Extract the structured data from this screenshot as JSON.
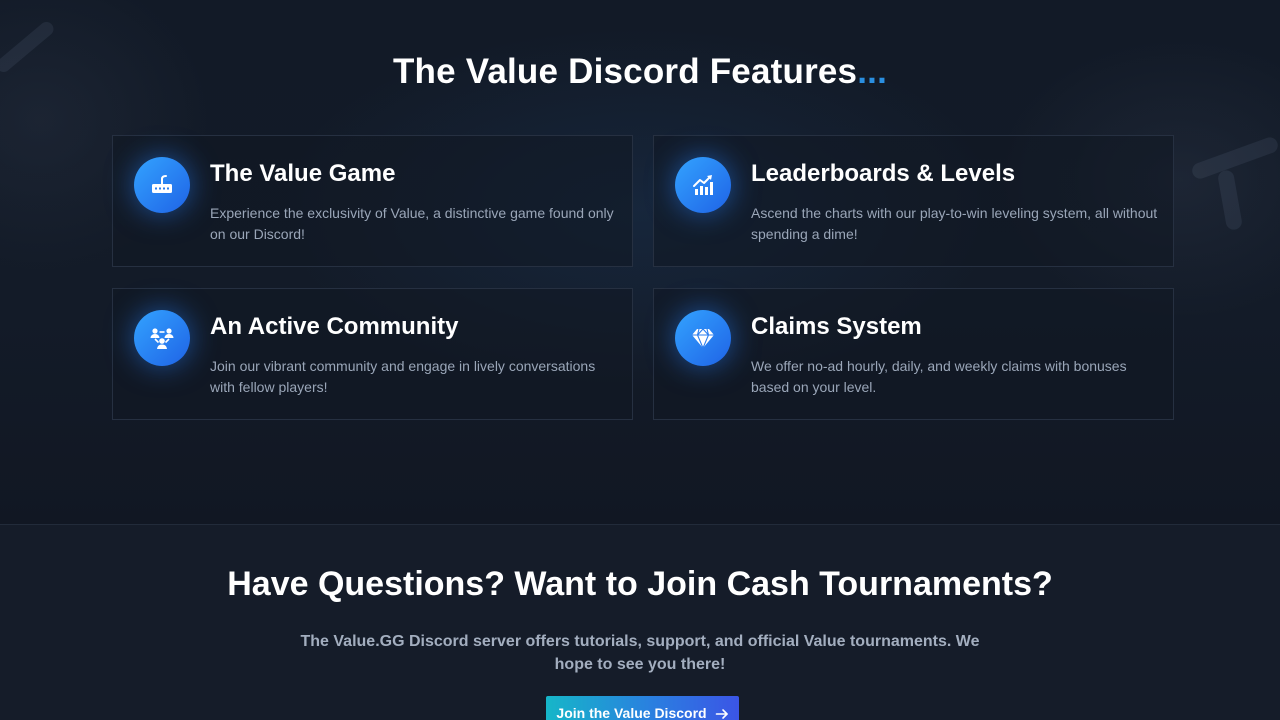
{
  "features": {
    "title": "The Value Discord Features",
    "title_suffix": "...",
    "accent_color": "#2a8fe0",
    "cards": [
      {
        "icon": "game-controller-icon",
        "title": "The Value Game",
        "description": "Experience the exclusivity of Value, a distinctive game found only on our Discord!"
      },
      {
        "icon": "chart-growth-icon",
        "title": "Leaderboards & Levels",
        "description": "Ascend the charts with our play-to-win leveling system, all without spending a dime!"
      },
      {
        "icon": "community-icon",
        "title": "An Active Community",
        "description": "Join our vibrant community and engage in lively conversations with fellow players!"
      },
      {
        "icon": "diamond-icon",
        "title": "Claims System",
        "description": "We offer no-ad hourly, daily, and weekly claims with bonuses based on your level."
      }
    ]
  },
  "questions": {
    "title": "Have Questions? Want to Join Cash Tournaments?",
    "description": "The Value.GG Discord server offers tutorials, support, and official Value tournaments. We hope to see you there!",
    "button_label": "Join the Value Discord",
    "button_icon": "arrow-right-icon"
  }
}
